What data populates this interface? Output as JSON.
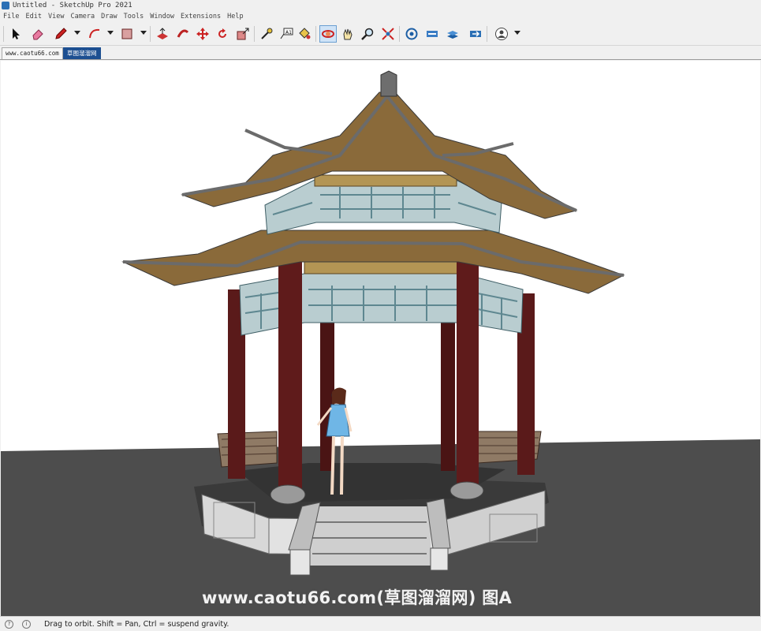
{
  "window": {
    "title": "Untitled - SketchUp Pro 2021"
  },
  "menu": [
    "File",
    "Edit",
    "View",
    "Camera",
    "Draw",
    "Tools",
    "Window",
    "Extensions",
    "Help"
  ],
  "tabs": [
    "www.caotu66.com",
    "草图溜溜网"
  ],
  "watermark": "www.caotu66.com(草图溜溜网) 图A",
  "status": {
    "hint": "Drag to orbit. Shift = Pan, Ctrl = suspend gravity."
  },
  "colors": {
    "accent": "#1d4f91",
    "ground": "#4a4a4a",
    "column": "#5a1a1a",
    "roof": "#8a6a3a",
    "lattice": "#6f9ba3"
  },
  "tools": [
    "select-icon",
    "eraser-icon",
    "pencil-icon",
    "arc-icon",
    "rectangle-icon",
    "push-pull-icon",
    "follow-me-icon",
    "move-icon",
    "rotate-icon",
    "scale-icon",
    "tape-measure-icon",
    "text-icon",
    "paint-bucket-icon",
    "orbit-icon",
    "pan-icon",
    "zoom-icon",
    "zoom-extents-icon",
    "warehouse-icon",
    "extension-warehouse-icon",
    "layout-icon",
    "send-to-layout-icon",
    "account-icon"
  ]
}
